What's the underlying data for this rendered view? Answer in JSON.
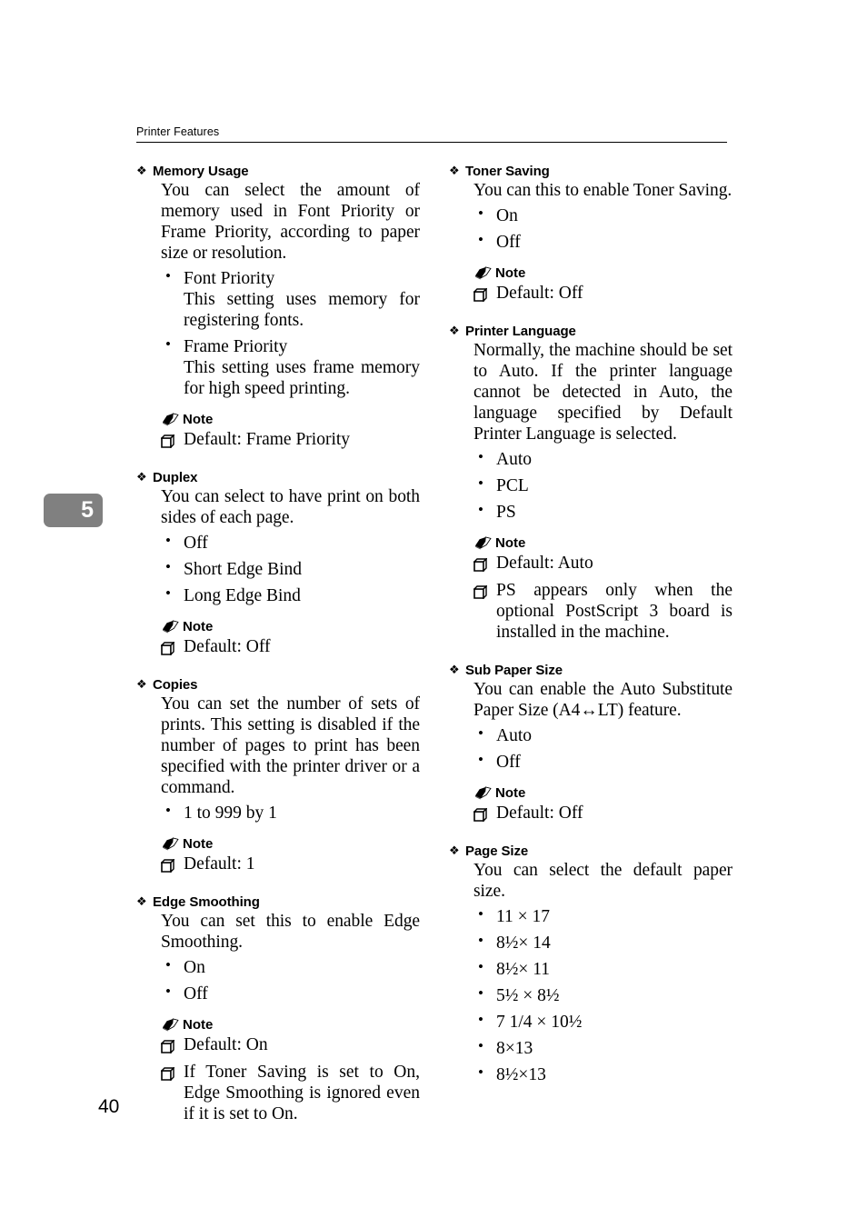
{
  "header": {
    "running_title": "Printer Features"
  },
  "chapter_tab": {
    "number": "5"
  },
  "folio": {
    "page_number": "40"
  },
  "labels": {
    "note_heading": "Note",
    "diamond_icon": "❖",
    "bullet_icon": "•"
  },
  "left_column": {
    "sections": [
      {
        "title": "Memory Usage",
        "body": "You can select the amount of memory used in Font Priority or Frame Priority, according to paper size or resolution.",
        "options": [
          {
            "label": "Font Priority",
            "detail": "This setting uses memory for registering fonts."
          },
          {
            "label": "Frame Priority",
            "detail": "This setting uses frame memory for high speed printing."
          }
        ],
        "note": {
          "heading": "Note",
          "items": [
            "Default: Frame Priority"
          ]
        }
      },
      {
        "title": "Duplex",
        "body": "You can select to have print on both sides of each page.",
        "options": [
          {
            "label": "Off"
          },
          {
            "label": "Short Edge Bind"
          },
          {
            "label": "Long Edge Bind"
          }
        ],
        "note": {
          "heading": "Note",
          "items": [
            "Default: Off"
          ]
        }
      },
      {
        "title": "Copies",
        "body": "You can set the number of sets of prints. This setting is disabled if the number of pages to print has been specified with the printer driver or a command.",
        "options": [
          {
            "label": "1 to 999 by 1"
          }
        ],
        "note": {
          "heading": "Note",
          "items": [
            "Default: 1"
          ]
        }
      },
      {
        "title": "Edge Smoothing",
        "body": "You can set this to enable Edge Smoothing.",
        "options": [
          {
            "label": "On"
          },
          {
            "label": "Off"
          }
        ],
        "note": {
          "heading": "Note",
          "items": [
            "Default: On",
            "If Toner Saving is set to On, Edge Smoothing is ignored even if it is set to On."
          ]
        }
      }
    ]
  },
  "right_column": {
    "sections": [
      {
        "title": "Toner Saving",
        "body": "You can this to enable Toner Saving.",
        "options": [
          {
            "label": "On"
          },
          {
            "label": "Off"
          }
        ],
        "note": {
          "heading": "Note",
          "items": [
            "Default: Off"
          ]
        }
      },
      {
        "title": "Printer Language",
        "body": "Normally, the machine should be set to Auto. If the printer language cannot be detected in Auto, the language specified by Default Printer Language is selected.",
        "options": [
          {
            "label": "Auto"
          },
          {
            "label": "PCL"
          },
          {
            "label": "PS"
          }
        ],
        "note": {
          "heading": "Note",
          "items": [
            "Default: Auto",
            "PS appears only when the optional PostScript 3 board is installed in the machine."
          ]
        }
      },
      {
        "title": "Sub Paper Size",
        "body": "You can enable the Auto Substitute Paper Size (A4↔LT) feature.",
        "options": [
          {
            "label": "Auto"
          },
          {
            "label": "Off"
          }
        ],
        "note": {
          "heading": "Note",
          "items": [
            "Default: Off"
          ]
        }
      },
      {
        "title": "Page Size",
        "body": "You can select the default paper size.",
        "options": [
          {
            "label": "11 × 17"
          },
          {
            "label": "8½× 14"
          },
          {
            "label": "8½× 11"
          },
          {
            "label": "5½ × 8½"
          },
          {
            "label": "7 1/4 × 10½"
          },
          {
            "label": "8×13"
          },
          {
            "label": "8½×13"
          }
        ],
        "note": null
      }
    ]
  }
}
